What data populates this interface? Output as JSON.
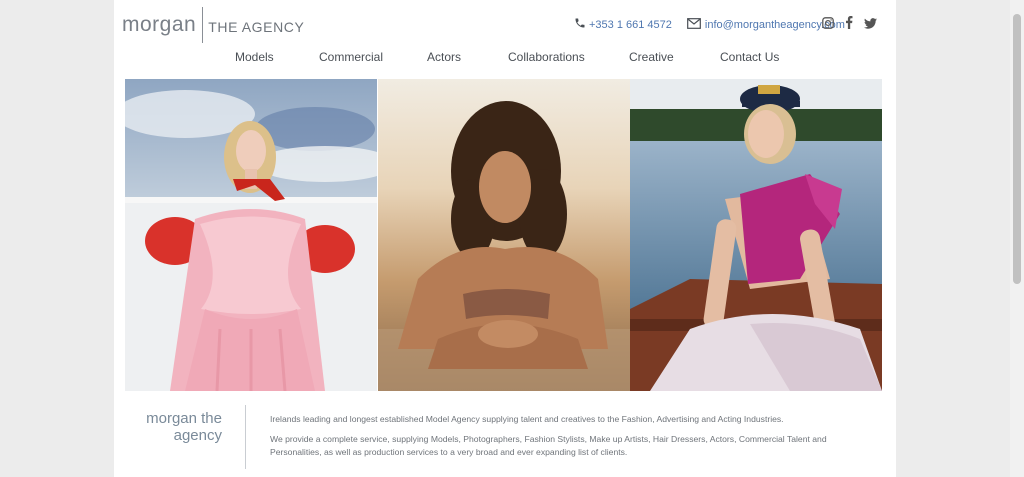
{
  "brand": {
    "logo_main": "morgan",
    "logo_sub": "THE AGENCY"
  },
  "contact": {
    "phone": "+353 1 661 4572",
    "email": "info@morgantheagency.com",
    "phone_icon": "phone-icon",
    "email_icon": "envelope-icon"
  },
  "social": {
    "icons": [
      "instagram-icon",
      "facebook-icon",
      "twitter-icon"
    ]
  },
  "nav": {
    "items": [
      {
        "label": "Models"
      },
      {
        "label": "Commercial"
      },
      {
        "label": "Actors"
      },
      {
        "label": "Collaborations"
      },
      {
        "label": "Creative"
      },
      {
        "label": "Contact Us"
      }
    ]
  },
  "about": {
    "title_line1": "morgan the",
    "title_line2": "agency",
    "paragraph1": "Irelands leading and longest established Model Agency supplying talent and creatives to the Fashion, Advertising and Acting Industries.",
    "paragraph2": "We provide a complete service, supplying Models, Photographers, Fashion Stylists, Make up Artists, Hair Dressers, Actors, Commercial Talent and Personalities, as well as production services to a very broad and ever expanding list of clients."
  },
  "colors": {
    "link": "#4f77b0",
    "nav_text": "#4a4f55",
    "page_bg": "#ececec"
  }
}
